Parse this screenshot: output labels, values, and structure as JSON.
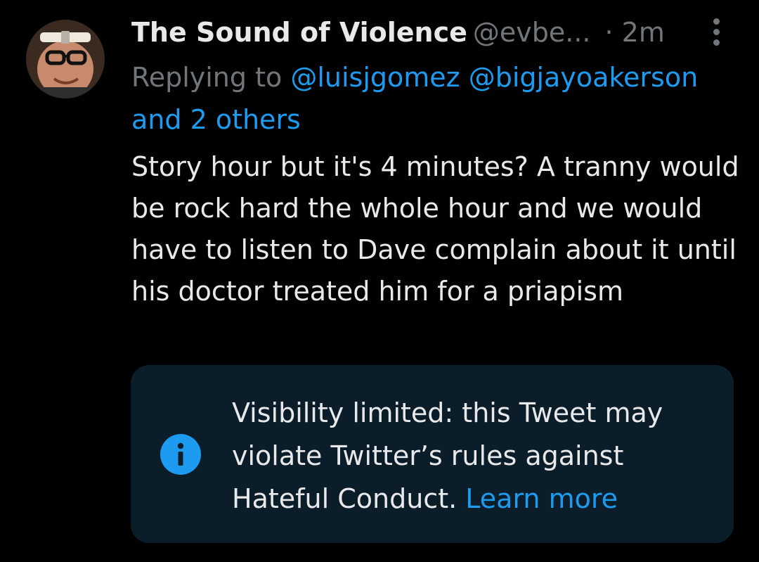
{
  "tweet": {
    "display_name": "The Sound of Violence",
    "handle": "@evbe...",
    "timestamp": "· 2m",
    "reply_prefix": "Replying to",
    "reply_mentions": [
      "@luisjgomez",
      "@bigjayoakerson"
    ],
    "reply_suffix": "and 2 others",
    "text": "Story hour but it's 4 minutes? A tranny would be rock hard the whole hour and we would have to listen to Dave complain about it until his doctor treated him for a priapism"
  },
  "notice": {
    "text": "Visibility limited: this Tweet may violate Twitter’s rules against Hateful Conduct.",
    "link": "Learn more"
  },
  "icons": {
    "avatar": "avatar",
    "more": "more-options-vertical-icon",
    "info": "info-icon"
  },
  "colors": {
    "background": "#000000",
    "text_primary": "#e7e9ea",
    "text_secondary": "#71767b",
    "accent": "#1d9bf0",
    "notice_background": "#0c1d2a"
  }
}
